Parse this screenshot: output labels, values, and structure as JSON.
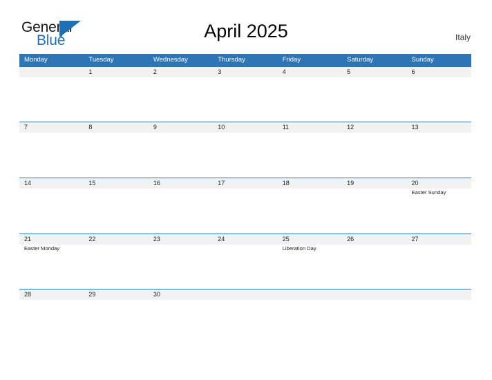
{
  "brand": {
    "name_top": "General",
    "name_bottom": "Blue",
    "accent_color": "#1f6fb5",
    "logo_icon": "triangle-flag-icon"
  },
  "header": {
    "title": "April 2025",
    "country": "Italy"
  },
  "colors": {
    "header_blue": "#2e75b6",
    "band_gray": "#f2f2f2",
    "text_dark": "#1c1c1c",
    "page_background": "#ffffff"
  },
  "calendar": {
    "month": "April",
    "year": "2025",
    "weekday_headers": [
      "Monday",
      "Tuesday",
      "Wednesday",
      "Thursday",
      "Friday",
      "Saturday",
      "Sunday"
    ],
    "weeks": [
      [
        {
          "date": "",
          "events": []
        },
        {
          "date": "1",
          "events": []
        },
        {
          "date": "2",
          "events": []
        },
        {
          "date": "3",
          "events": []
        },
        {
          "date": "4",
          "events": []
        },
        {
          "date": "5",
          "events": []
        },
        {
          "date": "6",
          "events": []
        }
      ],
      [
        {
          "date": "7",
          "events": []
        },
        {
          "date": "8",
          "events": []
        },
        {
          "date": "9",
          "events": []
        },
        {
          "date": "10",
          "events": []
        },
        {
          "date": "11",
          "events": []
        },
        {
          "date": "12",
          "events": []
        },
        {
          "date": "13",
          "events": []
        }
      ],
      [
        {
          "date": "14",
          "events": []
        },
        {
          "date": "15",
          "events": []
        },
        {
          "date": "16",
          "events": []
        },
        {
          "date": "17",
          "events": []
        },
        {
          "date": "18",
          "events": []
        },
        {
          "date": "19",
          "events": []
        },
        {
          "date": "20",
          "events": [
            "Easter Sunday"
          ]
        }
      ],
      [
        {
          "date": "21",
          "events": [
            "Easter Monday"
          ]
        },
        {
          "date": "22",
          "events": []
        },
        {
          "date": "23",
          "events": []
        },
        {
          "date": "24",
          "events": []
        },
        {
          "date": "25",
          "events": [
            "Liberation Day"
          ]
        },
        {
          "date": "26",
          "events": []
        },
        {
          "date": "27",
          "events": []
        }
      ],
      [
        {
          "date": "28",
          "events": []
        },
        {
          "date": "29",
          "events": []
        },
        {
          "date": "30",
          "events": []
        },
        {
          "date": "",
          "events": []
        },
        {
          "date": "",
          "events": []
        },
        {
          "date": "",
          "events": []
        },
        {
          "date": "",
          "events": []
        }
      ]
    ]
  }
}
